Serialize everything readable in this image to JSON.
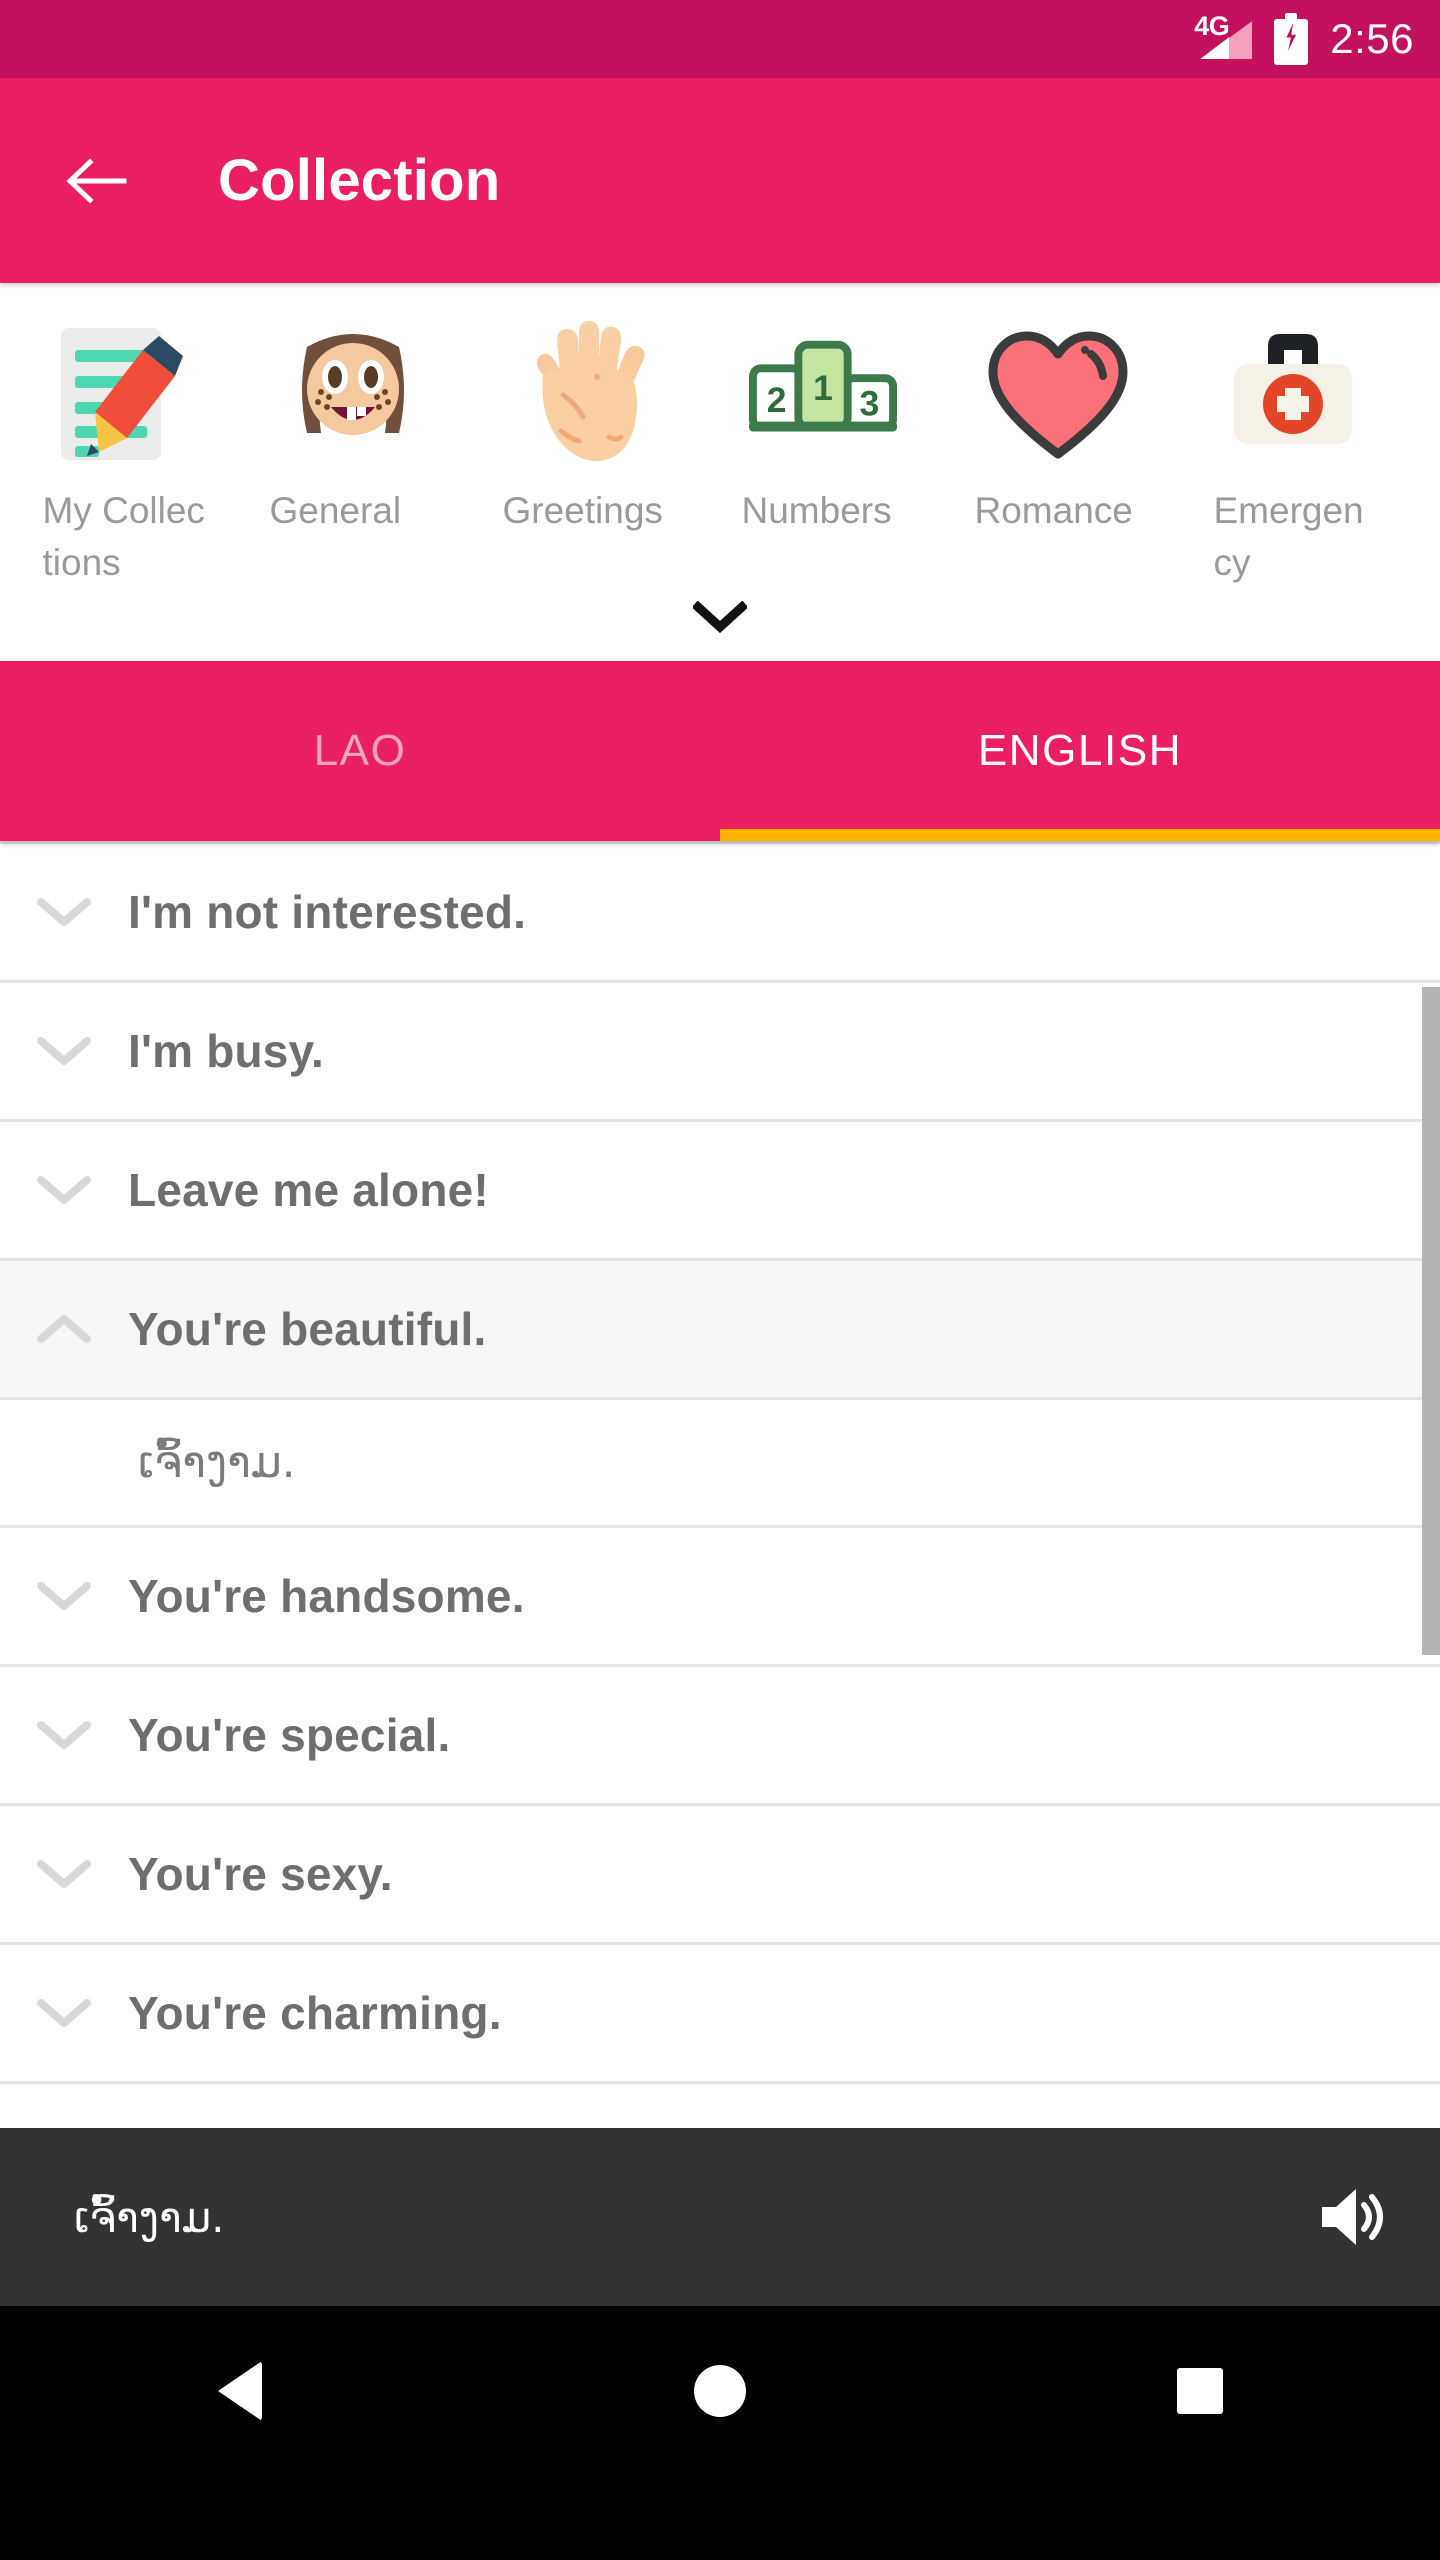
{
  "status_bar": {
    "network_label": "4G",
    "signal_icon": "signal-triangle-icon",
    "battery_icon": "battery-charging-icon",
    "time": "2:56",
    "background": "#C2125E"
  },
  "app_bar": {
    "back_icon": "arrow-left-icon",
    "title": "Collection",
    "background": "#E91E63"
  },
  "categories": {
    "expand_icon": "chevron-down-icon",
    "items": [
      {
        "label": "My Collections",
        "icon": "memo-pencil-icon"
      },
      {
        "label": "General",
        "icon": "face-with-freckles-icon"
      },
      {
        "label": "Greetings",
        "icon": "open-hand-icon"
      },
      {
        "label": "Numbers",
        "icon": "podium-123-icon"
      },
      {
        "label": "Romance",
        "icon": "heart-icon"
      },
      {
        "label": "Emergency",
        "icon": "first-aid-kit-icon"
      }
    ]
  },
  "tabs": {
    "active_index": 1,
    "indicator_color": "#FFB300",
    "items": [
      {
        "label": "LAO",
        "active": false
      },
      {
        "label": "ENGLISH",
        "active": true
      }
    ]
  },
  "phrase_list": {
    "rows": [
      {
        "text": "I'm not interested.",
        "expanded": false,
        "chevron": "chevron-down-icon"
      },
      {
        "text": "I'm busy.",
        "expanded": false,
        "chevron": "chevron-down-icon"
      },
      {
        "text": "Leave me alone!",
        "expanded": false,
        "chevron": "chevron-down-icon"
      },
      {
        "text": "You're beautiful.",
        "expanded": true,
        "chevron": "chevron-up-icon",
        "translation": "ເຈົ້າງາມ."
      },
      {
        "text": "You're handsome.",
        "expanded": false,
        "chevron": "chevron-down-icon"
      },
      {
        "text": "You're special.",
        "expanded": false,
        "chevron": "chevron-down-icon"
      },
      {
        "text": "You're sexy.",
        "expanded": false,
        "chevron": "chevron-down-icon"
      },
      {
        "text": "You're charming.",
        "expanded": false,
        "chevron": "chevron-down-icon"
      }
    ],
    "scrollbar": "vertical-scrollbar-thumb"
  },
  "player": {
    "text": "ເຈົ້າງາມ.",
    "speaker_icon": "volume-up-icon",
    "background": "#333333"
  },
  "nav_bar": {
    "back": "nav-back-icon",
    "home": "nav-home-icon",
    "recents": "nav-recents-icon"
  }
}
